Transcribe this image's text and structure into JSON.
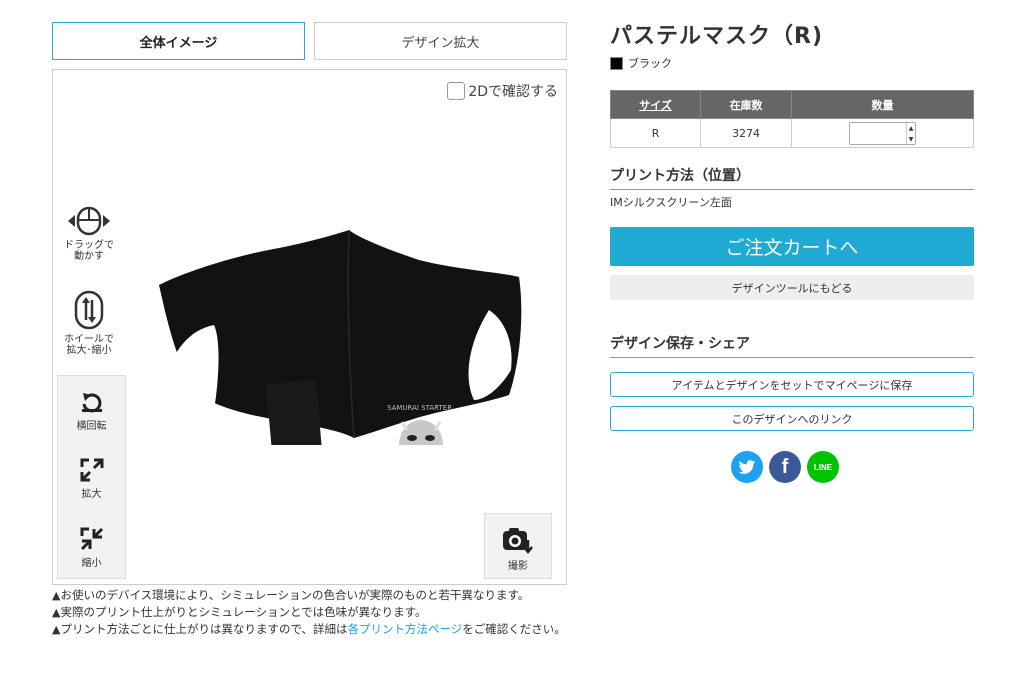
{
  "tabs": {
    "overall": "全体イメージ",
    "zoom": "デザイン拡大"
  },
  "viewer": {
    "check_2d": "2Dで確認する",
    "hint_drag": [
      "ドラッグで",
      "動かす"
    ],
    "hint_wheel": [
      "ホイールで",
      "拡大･縮小"
    ],
    "rotate": "横回転",
    "zoom_in": "拡大",
    "zoom_out": "縮小",
    "shoot": "撮影"
  },
  "notes": {
    "n1": "お使いのデバイス環境により、シミュレーションの色合いが実際のものと若干異なります。",
    "n2": "実際のプリント仕上がりとシミュレーションとでは色味が異なります。",
    "n3_pre": "プリント方法ごとに仕上がりは異なりますので、詳細は",
    "n3_link": "各プリント方法ページ",
    "n3_post": "をご確認ください。"
  },
  "product": {
    "title": "パステルマスク（R)",
    "color_name": "ブラック",
    "color_hex": "#000000"
  },
  "stock_table": {
    "headers": [
      "サイズ",
      "在庫数",
      "数量"
    ],
    "rows": [
      {
        "size": "R",
        "stock": "3274",
        "qty": ""
      }
    ]
  },
  "print": {
    "heading": "プリント方法（位置）",
    "method": "IMシルクスクリーン左面"
  },
  "buttons": {
    "cart": "ご注文カートへ",
    "back": "デザインツールにもどる",
    "save": "アイテムとデザインをセットでマイページに保存",
    "link": "このデザインへのリンク"
  },
  "share": {
    "heading": "デザイン保存・シェア",
    "line_label": "LINE"
  },
  "colors": {
    "accent": "#1eaad3",
    "table_header": "#666666"
  }
}
